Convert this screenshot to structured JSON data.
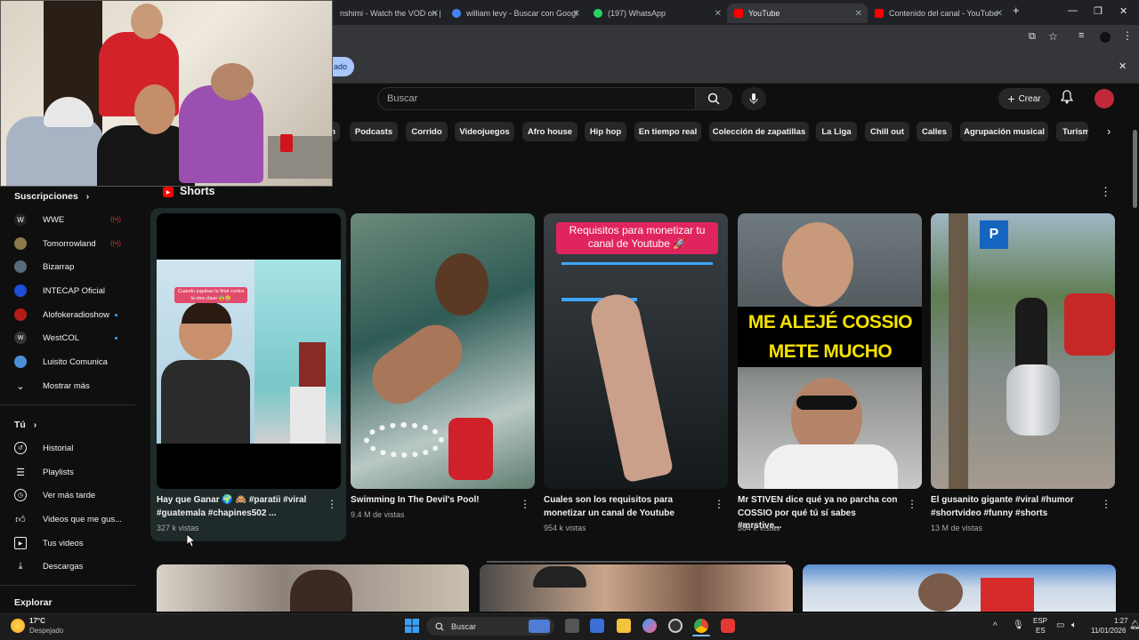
{
  "browser": {
    "tabs": [
      {
        "label": "nshimi - Watch the VOD on |",
        "favicon_color": "#9146ff"
      },
      {
        "label": "william levy - Buscar con Googl",
        "favicon_color": "#4285f4"
      },
      {
        "label": "(197) WhatsApp",
        "favicon_color": "#25d366"
      },
      {
        "label": "YouTube",
        "favicon_color": "#ff0000"
      },
      {
        "label": "Contenido del canal - YouTube",
        "favicon_color": "#ff0000"
      }
    ],
    "new_tab": "+",
    "pill_text": "ado"
  },
  "header": {
    "search_placeholder": "Buscar",
    "create_label": "Crear"
  },
  "chips": [
    "n",
    "Podcasts",
    "Corrido",
    "Videojuegos",
    "Afro house",
    "Hip hop",
    "En tiempo real",
    "Colección de zapatillas",
    "La Liga",
    "Chill out",
    "Calles",
    "Agrupación musical",
    "Turism"
  ],
  "sidebar": {
    "subscriptions_title": "Suscripciones",
    "subscriptions": [
      {
        "label": "WWE",
        "badge": "live"
      },
      {
        "label": "Tomorrowland",
        "badge": "live"
      },
      {
        "label": "Bizarrap",
        "badge": ""
      },
      {
        "label": "INTECAP Oficial",
        "badge": ""
      },
      {
        "label": "Alofokeradioshow",
        "badge": "dot"
      },
      {
        "label": "WestCOL",
        "badge": "dot"
      },
      {
        "label": "Luisito Comunica",
        "badge": ""
      },
      {
        "label": "Mostrar más",
        "badge": ""
      }
    ],
    "you_title": "Tú",
    "you_items": [
      {
        "label": "Historial",
        "icon": "history-icon"
      },
      {
        "label": "Playlists",
        "icon": "playlists-icon"
      },
      {
        "label": "Ver más tarde",
        "icon": "clock-icon"
      },
      {
        "label": "Videos que me gus...",
        "icon": "thumbs-up-icon"
      },
      {
        "label": "Tus videos",
        "icon": "video-icon"
      },
      {
        "label": "Descargas",
        "icon": "download-icon"
      }
    ],
    "explore_title": "Explorar"
  },
  "shorts": {
    "section_title": "Shorts",
    "items": [
      {
        "title_line1": "Hay que Ganar 🌍 🙈 #paratii #viral",
        "title_line2": "#guatemala #chapines502 ...",
        "views": "327 k vistas",
        "overlay_caption": "Cuando jugabas la final contra la otra clase 😨😢"
      },
      {
        "title_line1": "Swimming In The Devil's Pool!",
        "title_line2": "",
        "views": "9.4 M de vistas",
        "overlay_caption": ""
      },
      {
        "title_line1": "Cuales son los requisitos para",
        "title_line2": "monetizar un canal de Youtube",
        "views": "954 k vistas",
        "overlay_caption": "Requisitos para monetizar tu canal de Youtube 🚀"
      },
      {
        "title_line1": "Mr STIVEN dice qué ya no parcha con",
        "title_line2": "COSSIO por qué tú sí sabes #mrstive...",
        "views": "384 k vistas",
        "overlay_caption": "ME ALEJÉ COSSIO METE MUCHO"
      },
      {
        "title_line1": "El gusanito gigante #viral #humor",
        "title_line2": "#shortvideo #funny #shorts",
        "views": "13 M de vistas",
        "overlay_caption": ""
      }
    ]
  },
  "taskbar": {
    "weather_temp": "17°C",
    "weather_desc": "Despejado",
    "search_label": "Buscar",
    "lang": "ESP",
    "lang_sub": "ES",
    "time": "1:27",
    "date": "11/01/2026"
  },
  "colors": {
    "background": "#0f0f0f",
    "chip": "#272727",
    "accent_red": "#ff0000"
  }
}
